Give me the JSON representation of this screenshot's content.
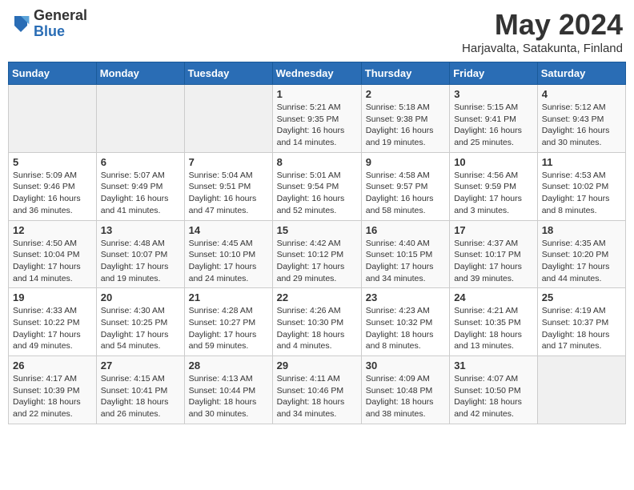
{
  "logo": {
    "general": "General",
    "blue": "Blue"
  },
  "header": {
    "month": "May 2024",
    "location": "Harjavalta, Satakunta, Finland"
  },
  "weekdays": [
    "Sunday",
    "Monday",
    "Tuesday",
    "Wednesday",
    "Thursday",
    "Friday",
    "Saturday"
  ],
  "weeks": [
    [
      {
        "day": "",
        "sunrise": "",
        "sunset": "",
        "daylight": ""
      },
      {
        "day": "",
        "sunrise": "",
        "sunset": "",
        "daylight": ""
      },
      {
        "day": "",
        "sunrise": "",
        "sunset": "",
        "daylight": ""
      },
      {
        "day": "1",
        "sunrise": "Sunrise: 5:21 AM",
        "sunset": "Sunset: 9:35 PM",
        "daylight": "Daylight: 16 hours and 14 minutes."
      },
      {
        "day": "2",
        "sunrise": "Sunrise: 5:18 AM",
        "sunset": "Sunset: 9:38 PM",
        "daylight": "Daylight: 16 hours and 19 minutes."
      },
      {
        "day": "3",
        "sunrise": "Sunrise: 5:15 AM",
        "sunset": "Sunset: 9:41 PM",
        "daylight": "Daylight: 16 hours and 25 minutes."
      },
      {
        "day": "4",
        "sunrise": "Sunrise: 5:12 AM",
        "sunset": "Sunset: 9:43 PM",
        "daylight": "Daylight: 16 hours and 30 minutes."
      }
    ],
    [
      {
        "day": "5",
        "sunrise": "Sunrise: 5:09 AM",
        "sunset": "Sunset: 9:46 PM",
        "daylight": "Daylight: 16 hours and 36 minutes."
      },
      {
        "day": "6",
        "sunrise": "Sunrise: 5:07 AM",
        "sunset": "Sunset: 9:49 PM",
        "daylight": "Daylight: 16 hours and 41 minutes."
      },
      {
        "day": "7",
        "sunrise": "Sunrise: 5:04 AM",
        "sunset": "Sunset: 9:51 PM",
        "daylight": "Daylight: 16 hours and 47 minutes."
      },
      {
        "day": "8",
        "sunrise": "Sunrise: 5:01 AM",
        "sunset": "Sunset: 9:54 PM",
        "daylight": "Daylight: 16 hours and 52 minutes."
      },
      {
        "day": "9",
        "sunrise": "Sunrise: 4:58 AM",
        "sunset": "Sunset: 9:57 PM",
        "daylight": "Daylight: 16 hours and 58 minutes."
      },
      {
        "day": "10",
        "sunrise": "Sunrise: 4:56 AM",
        "sunset": "Sunset: 9:59 PM",
        "daylight": "Daylight: 17 hours and 3 minutes."
      },
      {
        "day": "11",
        "sunrise": "Sunrise: 4:53 AM",
        "sunset": "Sunset: 10:02 PM",
        "daylight": "Daylight: 17 hours and 8 minutes."
      }
    ],
    [
      {
        "day": "12",
        "sunrise": "Sunrise: 4:50 AM",
        "sunset": "Sunset: 10:04 PM",
        "daylight": "Daylight: 17 hours and 14 minutes."
      },
      {
        "day": "13",
        "sunrise": "Sunrise: 4:48 AM",
        "sunset": "Sunset: 10:07 PM",
        "daylight": "Daylight: 17 hours and 19 minutes."
      },
      {
        "day": "14",
        "sunrise": "Sunrise: 4:45 AM",
        "sunset": "Sunset: 10:10 PM",
        "daylight": "Daylight: 17 hours and 24 minutes."
      },
      {
        "day": "15",
        "sunrise": "Sunrise: 4:42 AM",
        "sunset": "Sunset: 10:12 PM",
        "daylight": "Daylight: 17 hours and 29 minutes."
      },
      {
        "day": "16",
        "sunrise": "Sunrise: 4:40 AM",
        "sunset": "Sunset: 10:15 PM",
        "daylight": "Daylight: 17 hours and 34 minutes."
      },
      {
        "day": "17",
        "sunrise": "Sunrise: 4:37 AM",
        "sunset": "Sunset: 10:17 PM",
        "daylight": "Daylight: 17 hours and 39 minutes."
      },
      {
        "day": "18",
        "sunrise": "Sunrise: 4:35 AM",
        "sunset": "Sunset: 10:20 PM",
        "daylight": "Daylight: 17 hours and 44 minutes."
      }
    ],
    [
      {
        "day": "19",
        "sunrise": "Sunrise: 4:33 AM",
        "sunset": "Sunset: 10:22 PM",
        "daylight": "Daylight: 17 hours and 49 minutes."
      },
      {
        "day": "20",
        "sunrise": "Sunrise: 4:30 AM",
        "sunset": "Sunset: 10:25 PM",
        "daylight": "Daylight: 17 hours and 54 minutes."
      },
      {
        "day": "21",
        "sunrise": "Sunrise: 4:28 AM",
        "sunset": "Sunset: 10:27 PM",
        "daylight": "Daylight: 17 hours and 59 minutes."
      },
      {
        "day": "22",
        "sunrise": "Sunrise: 4:26 AM",
        "sunset": "Sunset: 10:30 PM",
        "daylight": "Daylight: 18 hours and 4 minutes."
      },
      {
        "day": "23",
        "sunrise": "Sunrise: 4:23 AM",
        "sunset": "Sunset: 10:32 PM",
        "daylight": "Daylight: 18 hours and 8 minutes."
      },
      {
        "day": "24",
        "sunrise": "Sunrise: 4:21 AM",
        "sunset": "Sunset: 10:35 PM",
        "daylight": "Daylight: 18 hours and 13 minutes."
      },
      {
        "day": "25",
        "sunrise": "Sunrise: 4:19 AM",
        "sunset": "Sunset: 10:37 PM",
        "daylight": "Daylight: 18 hours and 17 minutes."
      }
    ],
    [
      {
        "day": "26",
        "sunrise": "Sunrise: 4:17 AM",
        "sunset": "Sunset: 10:39 PM",
        "daylight": "Daylight: 18 hours and 22 minutes."
      },
      {
        "day": "27",
        "sunrise": "Sunrise: 4:15 AM",
        "sunset": "Sunset: 10:41 PM",
        "daylight": "Daylight: 18 hours and 26 minutes."
      },
      {
        "day": "28",
        "sunrise": "Sunrise: 4:13 AM",
        "sunset": "Sunset: 10:44 PM",
        "daylight": "Daylight: 18 hours and 30 minutes."
      },
      {
        "day": "29",
        "sunrise": "Sunrise: 4:11 AM",
        "sunset": "Sunset: 10:46 PM",
        "daylight": "Daylight: 18 hours and 34 minutes."
      },
      {
        "day": "30",
        "sunrise": "Sunrise: 4:09 AM",
        "sunset": "Sunset: 10:48 PM",
        "daylight": "Daylight: 18 hours and 38 minutes."
      },
      {
        "day": "31",
        "sunrise": "Sunrise: 4:07 AM",
        "sunset": "Sunset: 10:50 PM",
        "daylight": "Daylight: 18 hours and 42 minutes."
      },
      {
        "day": "",
        "sunrise": "",
        "sunset": "",
        "daylight": ""
      }
    ]
  ]
}
